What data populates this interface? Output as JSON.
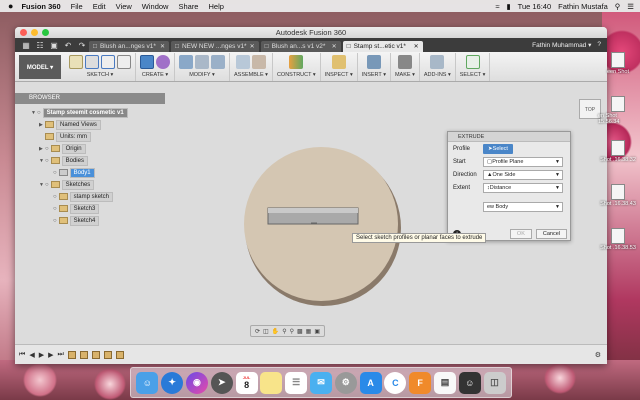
{
  "menubar": {
    "apple": "",
    "app": "Fusion 360",
    "items": [
      "File",
      "Edit",
      "View",
      "Window",
      "Share",
      "Help"
    ],
    "clock": "Tue 16:40",
    "user": "Fathin Mustafa"
  },
  "window": {
    "title": "Autodesk Fusion 360"
  },
  "tabs": [
    {
      "label": "Blush an...nges v1*"
    },
    {
      "label": "NEW NEW ...nges v1*"
    },
    {
      "label": "Blush an...s v1 v2*"
    },
    {
      "label": "Stamp st...etic v1*"
    }
  ],
  "account": {
    "name": "Fathin Muhammad ▾",
    "help": "?"
  },
  "toolbar": {
    "mode": "MODEL ▾",
    "groups": [
      "SKETCH ▾",
      "CREATE ▾",
      "MODIFY ▾",
      "ASSEMBLE ▾",
      "CONSTRUCT ▾",
      "INSPECT ▾",
      "INSERT ▾",
      "MAKE ▾",
      "ADD-INS ▾",
      "SELECT ▾"
    ]
  },
  "browser": {
    "title": "BROWSER",
    "nodes": [
      {
        "label": "Stamp steemit cosmetic v1"
      },
      {
        "label": "Named Views"
      },
      {
        "label": "Units: mm"
      },
      {
        "label": "Origin"
      },
      {
        "label": "Bodies"
      },
      {
        "label": "Body1"
      },
      {
        "label": "Sketches"
      },
      {
        "label": "stamp sketch"
      },
      {
        "label": "Sketch3"
      },
      {
        "label": "Sketch4"
      }
    ]
  },
  "viewcube": "TOP",
  "extrude": {
    "title": "EXTRUDE",
    "rows": [
      {
        "label": "Profile",
        "value": "Select"
      },
      {
        "label": "Start",
        "value": "Profile Plane"
      },
      {
        "label": "Direction",
        "value": "One Side"
      },
      {
        "label": "Extent",
        "value": "Distance"
      },
      {
        "label": "",
        "value": "ew Body"
      }
    ],
    "ok": "OK",
    "cancel": "Cancel",
    "info": "i"
  },
  "tooltip": "Select sketch profiles or planar faces to extrude",
  "desktop_icons": [
    {
      "label": "een Shot"
    },
    {
      "label": "en Shot 15.56.34"
    },
    {
      "label": "Shot .16.38.32"
    },
    {
      "label": "Shot .16.38.43"
    },
    {
      "label": "Shot .16.38.53"
    }
  ],
  "dock": {
    "calendar_day": "8",
    "calendar_month": "JUL"
  }
}
